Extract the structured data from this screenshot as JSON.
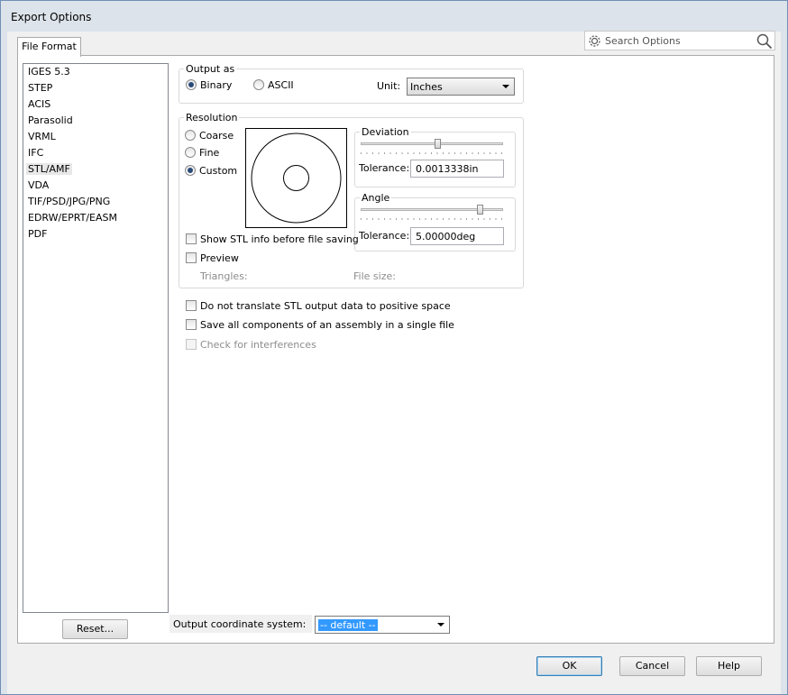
{
  "window": {
    "title": "Export Options"
  },
  "tabs": [
    {
      "label": "File Format"
    }
  ],
  "search": {
    "placeholder": "Search Options"
  },
  "formats": {
    "items": [
      {
        "label": "IGES 5.3"
      },
      {
        "label": "STEP"
      },
      {
        "label": "ACIS"
      },
      {
        "label": "Parasolid"
      },
      {
        "label": "VRML"
      },
      {
        "label": "IFC"
      },
      {
        "label": "STL/AMF",
        "selected": true
      },
      {
        "label": "VDA"
      },
      {
        "label": "TIF/PSD/JPG/PNG"
      },
      {
        "label": "EDRW/EPRT/EASM"
      },
      {
        "label": "PDF"
      }
    ]
  },
  "reset_button": "Reset...",
  "output_as": {
    "title": "Output as",
    "binary_label": "Binary",
    "ascii_label": "ASCII",
    "selected": "Binary",
    "unit_label": "Unit:",
    "unit_value": "Inches"
  },
  "resolution": {
    "title": "Resolution",
    "coarse_label": "Coarse",
    "fine_label": "Fine",
    "custom_label": "Custom",
    "selected": "Custom",
    "deviation": {
      "title": "Deviation",
      "tolerance_label": "Tolerance:",
      "tolerance_value": "0.0013338in",
      "slider_fraction": 0.54
    },
    "angle": {
      "title": "Angle",
      "tolerance_label": "Tolerance:",
      "tolerance_value": "5.00000deg",
      "slider_fraction": 0.84
    },
    "show_info_label": "Show STL info before file saving",
    "preview_label": "Preview",
    "triangles_label": "Triangles:",
    "file_size_label": "File size:"
  },
  "options": {
    "no_translate_label": "Do not translate STL output data to positive space",
    "save_all_label": "Save all components of an assembly in a single file",
    "check_interferences_label": "Check for interferences"
  },
  "coordinate": {
    "label": "Output coordinate system:",
    "value": "-- default --"
  },
  "footer": {
    "ok": "OK",
    "cancel": "Cancel",
    "help": "Help"
  },
  "colors": {
    "title_bg": "#dde3ea",
    "selection": "#3399ff",
    "window_border": "#6f8fb5"
  }
}
